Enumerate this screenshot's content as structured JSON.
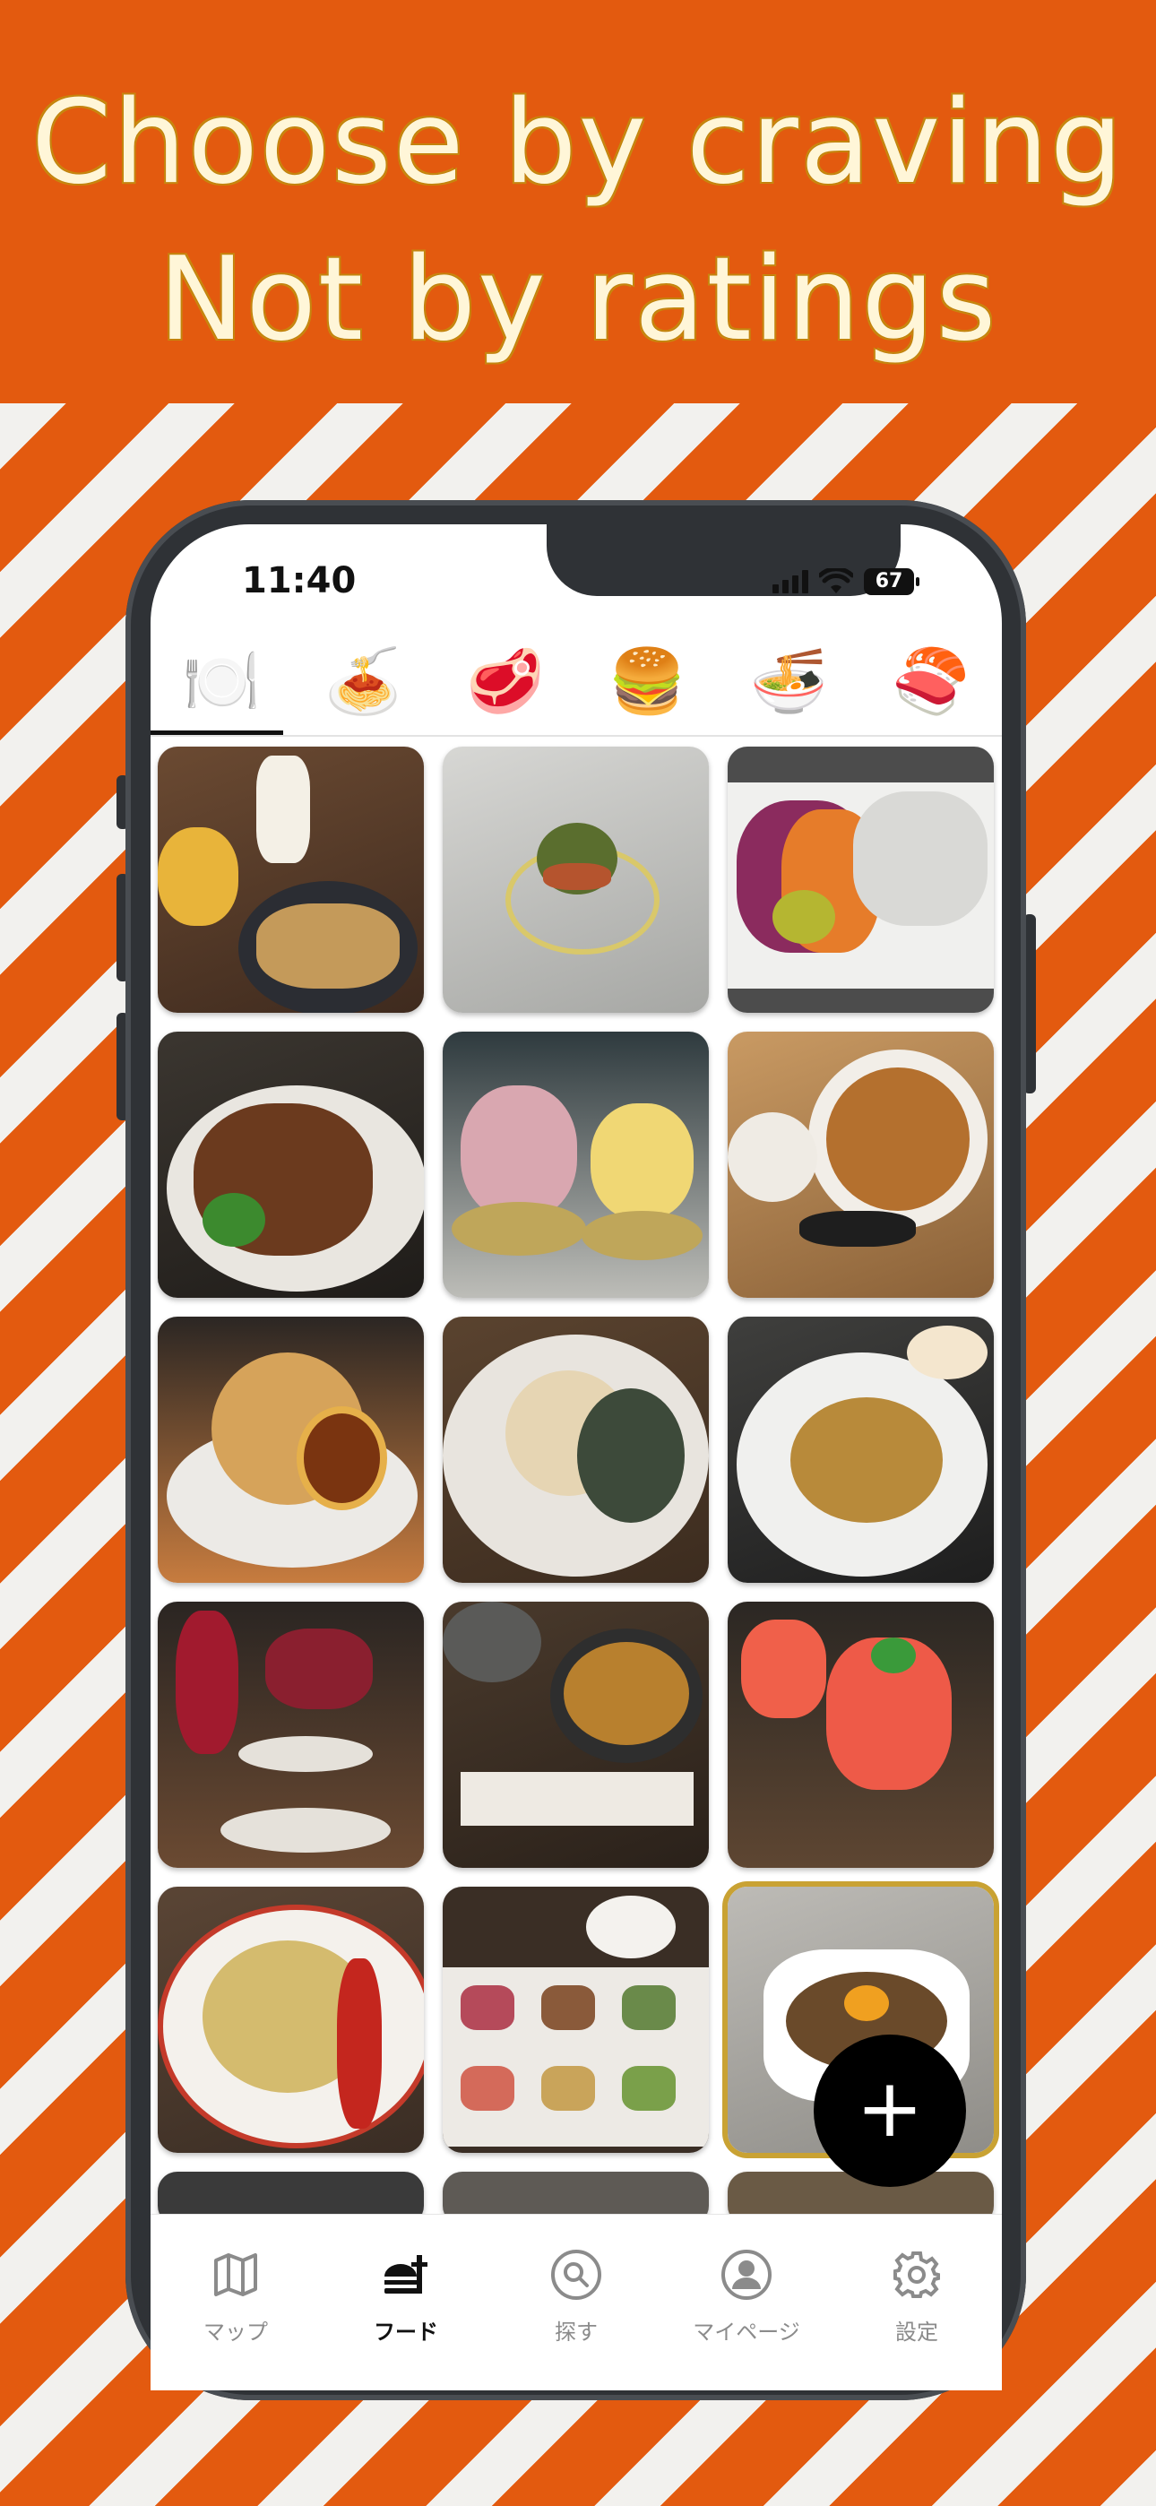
{
  "promo": {
    "line1": "Choose by craving",
    "line2": "Not by ratings"
  },
  "status_bar": {
    "time": "11:40",
    "battery": "67"
  },
  "categories": [
    {
      "icon": "plate-cutlery-icon",
      "emoji": "🍽️",
      "selected": true
    },
    {
      "icon": "spaghetti-icon",
      "emoji": "🍝",
      "selected": false
    },
    {
      "icon": "steak-icon",
      "emoji": "🥩",
      "selected": false
    },
    {
      "icon": "hamburger-icon",
      "emoji": "🍔",
      "selected": false
    },
    {
      "icon": "ramen-bowl-icon",
      "emoji": "🍜",
      "selected": false
    },
    {
      "icon": "sushi-icon",
      "emoji": "🍣",
      "selected": false
    }
  ],
  "fab": {
    "label": "+"
  },
  "tabbar": {
    "tabs": [
      {
        "label": "マップ",
        "icon": "map-icon",
        "active": false
      },
      {
        "label": "フード",
        "icon": "food-icon",
        "active": true
      },
      {
        "label": "探す",
        "icon": "search-icon",
        "active": false
      },
      {
        "label": "マイページ",
        "icon": "profile-icon",
        "active": false
      },
      {
        "label": "設定",
        "icon": "gear-icon",
        "active": false
      }
    ]
  },
  "colors": {
    "background": "#E35A0F",
    "stripe": "#F2F1EE",
    "headline": "#FFF6D8",
    "phone_frame": "#2F3236",
    "selected_border": "#C9A233"
  }
}
